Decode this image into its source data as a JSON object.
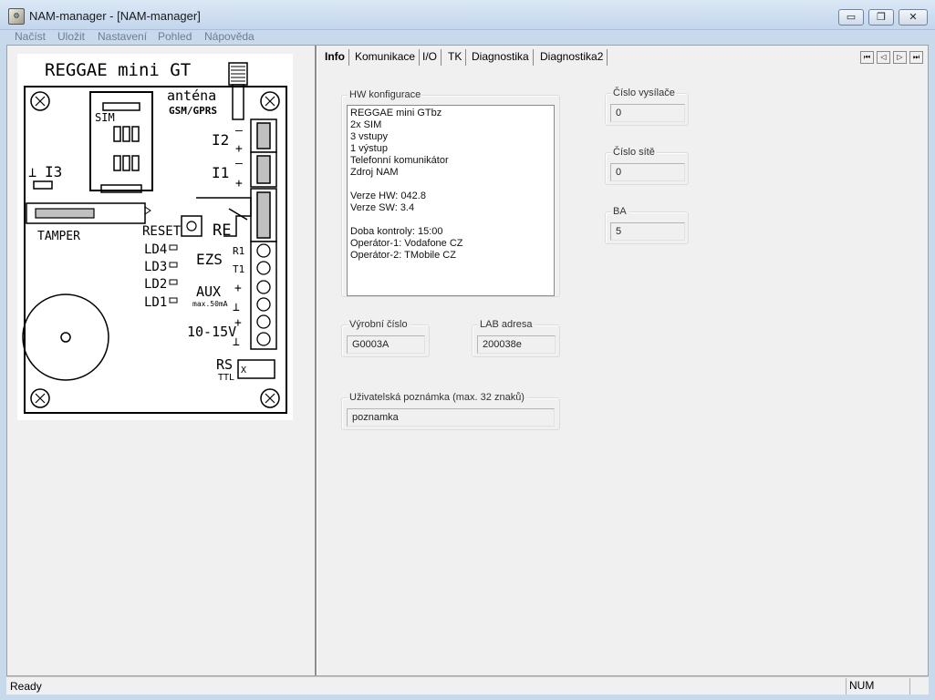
{
  "window": {
    "title": "NAM-manager - [NAM-manager]",
    "buttons": {
      "minimize": "▭",
      "restore": "❐",
      "close": "✕"
    }
  },
  "menu": [
    "Načíst",
    "Uložit",
    "Nastavení",
    "Pohled",
    "Nápověda"
  ],
  "board": {
    "title": "REGGAE mini GT",
    "antenna": "anténa",
    "antenna_sub": "GSM/GPRS",
    "sim": "SIM",
    "i2": "I2",
    "i1": "I1",
    "i3": "I3",
    "ground": "⊥",
    "minus": "–",
    "plus": "+",
    "tamper": "TAMPER",
    "reset": "RESET",
    "re": "RE",
    "leds": [
      "LD4",
      "LD3",
      "LD2",
      "LD1"
    ],
    "ezs": "EZS",
    "r1": "R1",
    "t1": "T1",
    "aux": "AUX",
    "aux_sub": "max.50mA",
    "voltage": "10-15V",
    "rs": "RS",
    "rs_sub": "TTL",
    "rs_connector": "X"
  },
  "tabs": [
    "Info",
    "Komunikace",
    "I/O",
    "TK",
    "Diagnostika",
    "Diagnostika2"
  ],
  "tab_nav": [
    "⏮",
    "◁",
    "▷",
    "⏭"
  ],
  "info": {
    "hw_label": "HW konfigurace",
    "hw_lines": [
      "REGGAE mini GTbz",
      "2x SIM",
      "3 vstupy",
      "1 výstup",
      "Telefonní komunikátor",
      "Zdroj NAM",
      "",
      "Verze HW: 042.8",
      "Verze SW: 3.4",
      "",
      "Doba kontroly: 15:00",
      "Operátor-1: Vodafone CZ",
      "Operátor-2: TMobile CZ"
    ],
    "serial_label": "Výrobní číslo",
    "serial_value": "G0003A",
    "lab_label": "LAB adresa",
    "lab_value": "200038e",
    "note_label": "Uživatelská poznámka (max. 32 znaků)",
    "note_value": "poznamka",
    "transmitter_label": "Číslo vysílače",
    "transmitter_value": "0",
    "network_label": "Číslo sítě",
    "network_value": "0",
    "ba_label": "BA",
    "ba_value": "5"
  },
  "status": {
    "text": "Ready",
    "num": "NUM"
  }
}
